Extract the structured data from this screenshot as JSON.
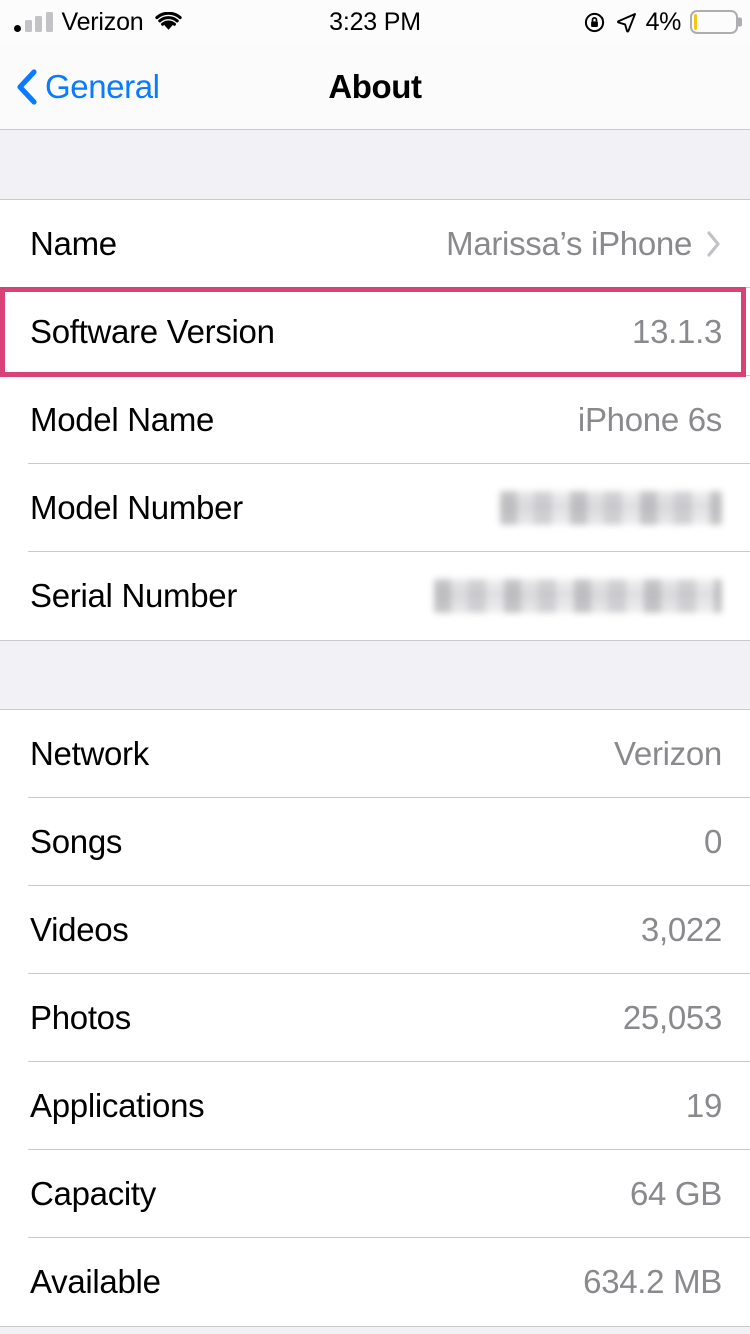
{
  "status_bar": {
    "carrier": "Verizon",
    "signal_bars_filled": 1,
    "signal_bars_total": 4,
    "wifi_icon": "wifi-icon",
    "time": "3:23 PM",
    "rotation_lock_icon": "rotation-lock-icon",
    "location_icon": "location-arrow-icon",
    "battery_percent": "4%",
    "battery_level": 4,
    "battery_fill_color": "#F5C518",
    "battery_outline_color": "#AEAEB2"
  },
  "nav_bar": {
    "back_label": "General",
    "back_icon": "chevron-left-icon",
    "title": "About",
    "tint_color": "#0A7AFF"
  },
  "highlight": {
    "target_row": "Software Version",
    "color": "#D94277"
  },
  "sections": [
    {
      "id": "device-info",
      "rows": [
        {
          "label": "Name",
          "value": "Marissa’s iPhone",
          "disclosure": true,
          "redacted": false
        },
        {
          "label": "Software Version",
          "value": "13.1.3",
          "disclosure": false,
          "redacted": false,
          "highlighted": true
        },
        {
          "label": "Model Name",
          "value": "iPhone 6s",
          "disclosure": false,
          "redacted": false
        },
        {
          "label": "Model Number",
          "value": "",
          "disclosure": false,
          "redacted": true,
          "redact_style": "model"
        },
        {
          "label": "Serial Number",
          "value": "",
          "disclosure": false,
          "redacted": true,
          "redact_style": "serial"
        }
      ]
    },
    {
      "id": "usage-info",
      "rows": [
        {
          "label": "Network",
          "value": "Verizon",
          "disclosure": false,
          "redacted": false
        },
        {
          "label": "Songs",
          "value": "0",
          "disclosure": false,
          "redacted": false
        },
        {
          "label": "Videos",
          "value": "3,022",
          "disclosure": false,
          "redacted": false
        },
        {
          "label": "Photos",
          "value": "25,053",
          "disclosure": false,
          "redacted": false
        },
        {
          "label": "Applications",
          "value": "19",
          "disclosure": false,
          "redacted": false
        },
        {
          "label": "Capacity",
          "value": "64 GB",
          "disclosure": false,
          "redacted": false
        },
        {
          "label": "Available",
          "value": "634.2 MB",
          "disclosure": false,
          "redacted": false
        }
      ]
    }
  ]
}
